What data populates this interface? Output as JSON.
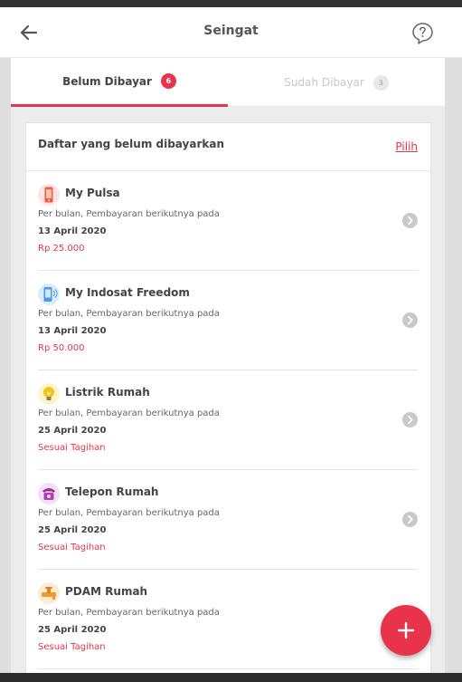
{
  "appbar": {
    "title": "Seingat",
    "back_icon": "arrow-left-icon",
    "help_icon": "question-mark-icon"
  },
  "tabs": [
    {
      "label": "Belum Dibayar",
      "count": "6",
      "active": true
    },
    {
      "label": "Sudah Dibayar",
      "count": "3",
      "active": false
    }
  ],
  "list": {
    "header": "Daftar yang belum dibayarkan",
    "select_label": "Pilih",
    "items": [
      {
        "name": "My Pulsa",
        "icon": "mobile-phone-icon",
        "subtitle": "Per bulan, Pembayaran berikutnya pada",
        "date": "13 April 2020",
        "amount": "Rp 25.000"
      },
      {
        "name": "My Indosat Freedom",
        "icon": "mobile-data-icon",
        "subtitle": "Per bulan, Pembayaran berikutnya pada",
        "date": "13 April 2020",
        "amount": "Rp 50.000"
      },
      {
        "name": "Listrik Rumah",
        "icon": "light-bulb-icon",
        "subtitle": "Per bulan, Pembayaran berikutnya pada",
        "date": "25 April 2020",
        "amount": "Sesuai Tagihan"
      },
      {
        "name": "Telepon Rumah",
        "icon": "telephone-icon",
        "subtitle": "Per bulan, Pembayaran berikutnya pada",
        "date": "25 April 2020",
        "amount": "Sesuai Tagihan"
      },
      {
        "name": "PDAM Rumah",
        "icon": "water-tap-icon",
        "subtitle": "Per bulan, Pembayaran berikutnya pada",
        "date": "25 April 2020",
        "amount": "Sesuai Tagihan"
      }
    ]
  },
  "fab_icon": "plus-icon",
  "colors": {
    "accent": "#e8334a",
    "background": "#ececec"
  }
}
